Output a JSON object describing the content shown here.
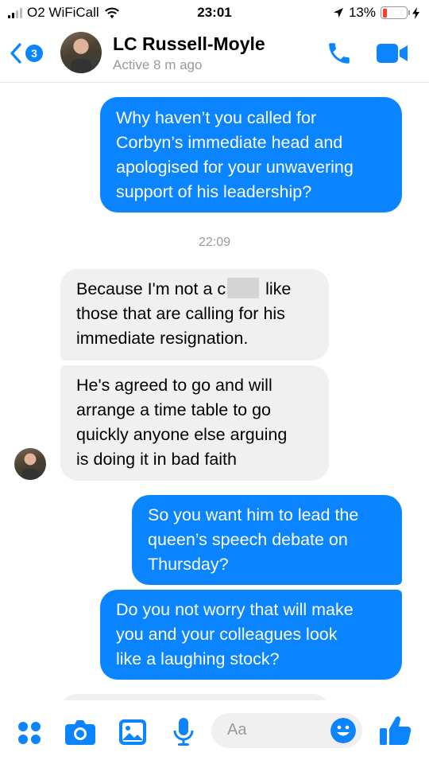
{
  "status_bar": {
    "carrier": "O2 WiFiCall",
    "time": "23:01",
    "battery": "13%"
  },
  "header": {
    "back_badge": "3",
    "contact_name": "LC Russell-Moyle",
    "contact_status": "Active 8 m ago"
  },
  "messages": [
    {
      "from": "me",
      "lines": [
        "Why haven’t you called for",
        "Corbyn’s immediate head and",
        "apologised for your unwavering",
        "support of his leadership?"
      ]
    },
    {
      "from": "contact",
      "line1_before": "Because I'm not a c",
      "line1_after": " like",
      "lines": [
        "those that are calling for his",
        "immediate resignation."
      ]
    },
    {
      "from": "contact",
      "lines": [
        "He's agreed to go and will",
        "arrange a time table to go",
        "quickly anyone else arguing",
        "is doing it in bad faith"
      ]
    },
    {
      "from": "me",
      "lines": [
        "So you want him to lead the",
        "queen’s speech debate on",
        "Thursday?"
      ]
    },
    {
      "from": "me",
      "lines": [
        "Do you not worry that will make",
        "you and your colleagues look",
        "like a laughing stock?"
      ]
    }
  ],
  "timestamp": "22:09",
  "composer": {
    "placeholder": "Aa"
  },
  "colors": {
    "accent": "#0a84ff",
    "incoming_bubble": "#f0f0f0",
    "battery_low": "#ff3b30"
  },
  "icons": [
    "apps-icon",
    "camera-icon",
    "gallery-icon",
    "microphone-icon",
    "emoji-icon",
    "thumbs-up-icon",
    "phone-icon",
    "video-camera-icon",
    "wifi-icon",
    "location-arrow-icon",
    "charging-bolt-icon"
  ]
}
